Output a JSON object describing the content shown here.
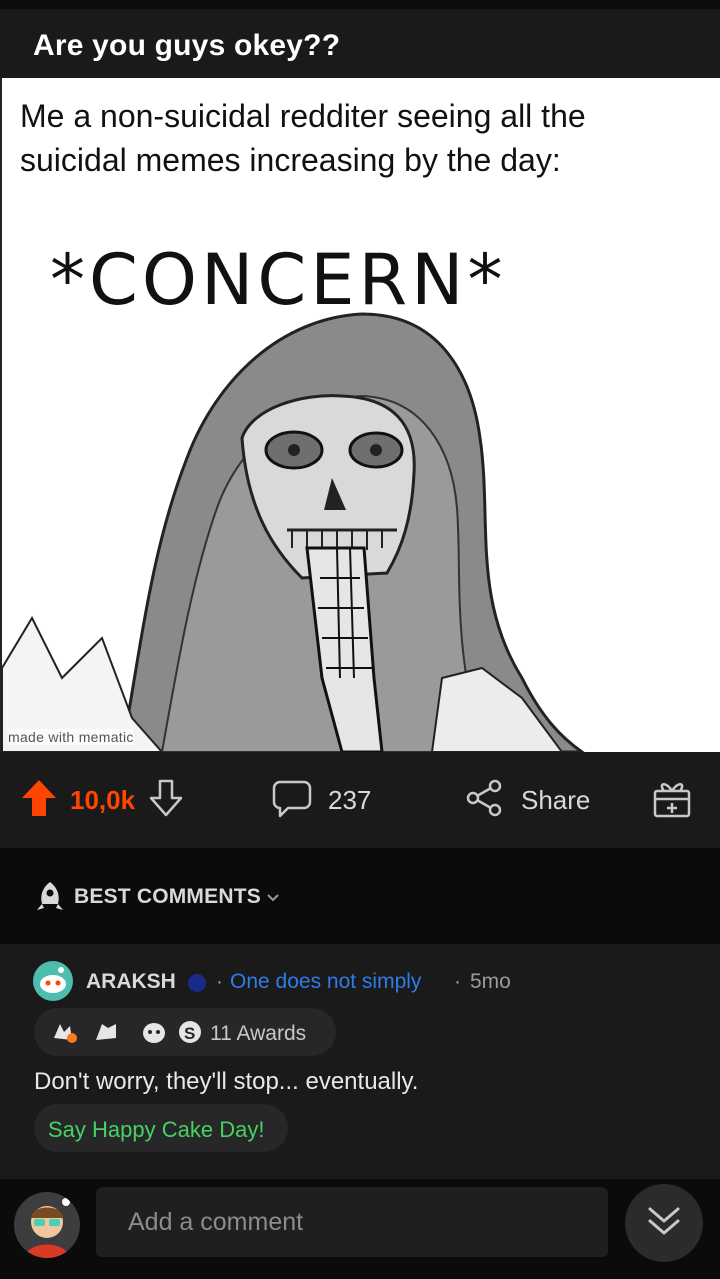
{
  "post": {
    "title": "Are you guys okey??",
    "meme": {
      "caption": "Me a non-suicidal redditer seeing all the suicidal memes increasing by the day:",
      "headline": "*CONCERN*",
      "watermark": "made with mematic"
    },
    "upvotes": "10,0k",
    "comments_count": "237",
    "share_label": "Share",
    "accent_color": "#ff4500"
  },
  "sort": {
    "label": "BEST COMMENTS"
  },
  "comment": {
    "author": "ARAKSH",
    "flair": "One does not simply",
    "age": "5mo",
    "awards_label": "11 Awards",
    "body": "Don't worry, they'll stop... eventually.",
    "cake_day_label": "Say Happy Cake Day!"
  },
  "composer": {
    "placeholder": "Add a comment"
  },
  "icons": [
    "upvote-icon",
    "downvote-icon",
    "comment-icon",
    "share-icon",
    "award-icon",
    "rocket-icon",
    "chevron-down-icon",
    "snoo-avatar-icon",
    "collapse-chevrons-icon"
  ]
}
